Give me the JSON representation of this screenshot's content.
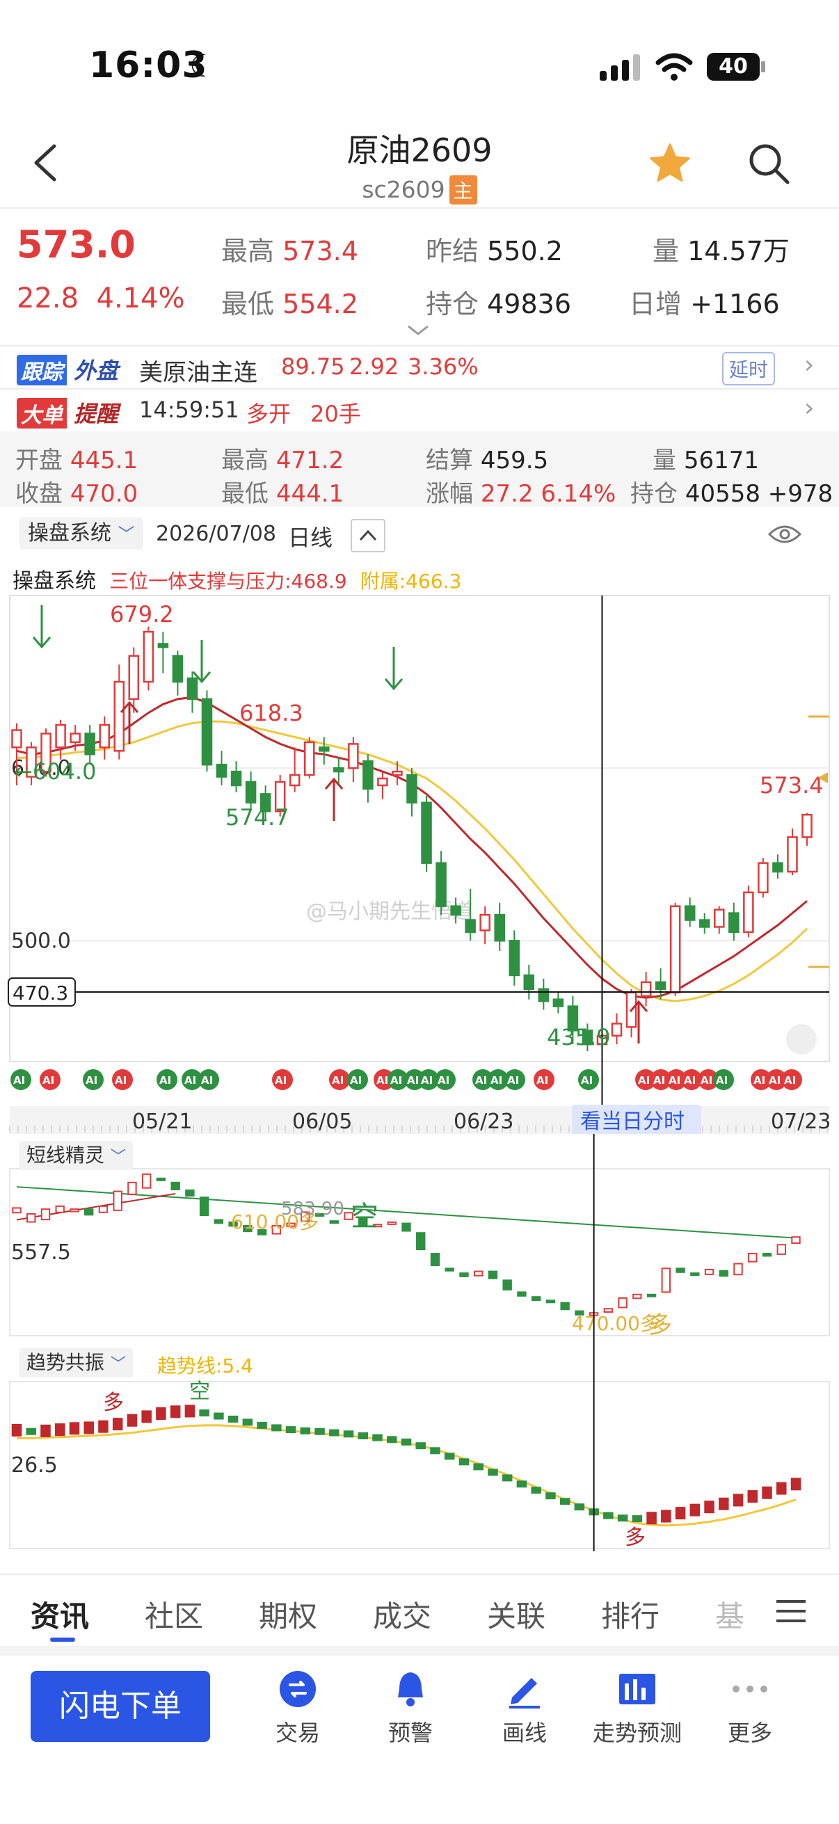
{
  "status": {
    "time": "16:03",
    "battery": "40"
  },
  "header": {
    "title": "原油2609",
    "code": "sc2609",
    "badge": "主"
  },
  "quote": {
    "price": "573.0",
    "change": "22.8",
    "change_pct": "4.14%",
    "high_label": "最高",
    "high": "573.4",
    "low_label": "最低",
    "low": "554.2",
    "prev_settle_label": "昨结",
    "prev_settle": "550.2",
    "open_interest_label": "持仓",
    "open_interest": "49836",
    "volume_label": "量",
    "volume": "14.57万",
    "daily_inc_label": "日增",
    "daily_inc": "+1166"
  },
  "track": {
    "tag1": "跟踪",
    "tag2": "外盘",
    "name": "美原油主连",
    "price": "89.75",
    "change": "2.92",
    "pct": "3.36%",
    "delay": "延时"
  },
  "alert": {
    "tag1": "大单",
    "tag2": "提醒",
    "time": "14:59:51",
    "action": "多开",
    "lots": "20手"
  },
  "daybar": {
    "open_label": "开盘",
    "open": "445.1",
    "close_label": "收盘",
    "close": "470.0",
    "high_label": "最高",
    "high": "471.2",
    "low_label": "最低",
    "low": "444.1",
    "settle_label": "结算",
    "settle": "459.5",
    "chg_label": "涨幅",
    "chg": "27.2 6.14%",
    "vol_label": "量",
    "vol": "56171",
    "oi_label": "持仓",
    "oi": "40558 +978"
  },
  "chart_toolbar": {
    "system": "操盘系统",
    "date": "2026/07/08",
    "period": "日线"
  },
  "main_chart": {
    "label": "操盘系统",
    "indicator": "三位一体支撑与压力:468.9",
    "sub_indicator": "附属:466.3",
    "y_labels": [
      "600.0",
      "500.0"
    ],
    "cursor_value": "470.3",
    "annotations": {
      "high": "679.2",
      "pt618": "618.3",
      "pt604": "←604.0",
      "pt5747": "574.7",
      "low": "435.9",
      "last": "573.4"
    },
    "x_labels": [
      "05/21",
      "06/05",
      "06/23",
      "07/23"
    ],
    "view_button": "看当日分时",
    "watermark": "@马小期先生悟道"
  },
  "chart_data": {
    "type": "candlestick",
    "ylim": [
      430,
      700
    ],
    "cursor_index": 40,
    "candles": [
      [
        612,
        622,
        590,
        626
      ],
      [
        595,
        612,
        590,
        615
      ],
      [
        598,
        620,
        595,
        623
      ],
      [
        612,
        625,
        605,
        628
      ],
      [
        615,
        620,
        610,
        625
      ],
      [
        620,
        608,
        602,
        625
      ],
      [
        612,
        625,
        605,
        630
      ],
      [
        610,
        650,
        605,
        660
      ],
      [
        640,
        665,
        632,
        670
      ],
      [
        650,
        679,
        645,
        682
      ],
      [
        672,
        670,
        655,
        679
      ],
      [
        665,
        650,
        642,
        668
      ],
      [
        652,
        640,
        632,
        656
      ],
      [
        640,
        602,
        598,
        645
      ],
      [
        602,
        595,
        590,
        610
      ],
      [
        598,
        590,
        586,
        604
      ],
      [
        592,
        580,
        576,
        598
      ],
      [
        585,
        575,
        570,
        590
      ],
      [
        575,
        592,
        572,
        596
      ],
      [
        590,
        596,
        586,
        612
      ],
      [
        596,
        615,
        594,
        618
      ],
      [
        612,
        610,
        602,
        618
      ],
      [
        600,
        598,
        590,
        606
      ],
      [
        600,
        614,
        592,
        618
      ],
      [
        604,
        588,
        580,
        608
      ],
      [
        590,
        594,
        582,
        598
      ],
      [
        596,
        598,
        590,
        604
      ],
      [
        596,
        580,
        572,
        600
      ],
      [
        580,
        545,
        540,
        584
      ],
      [
        545,
        520,
        515,
        552
      ],
      [
        520,
        515,
        510,
        525
      ],
      [
        512,
        505,
        500,
        530
      ],
      [
        506,
        515,
        498,
        520
      ],
      [
        515,
        500,
        494,
        522
      ],
      [
        500,
        480,
        474,
        506
      ],
      [
        480,
        472,
        466,
        486
      ],
      [
        472,
        465,
        460,
        478
      ],
      [
        466,
        462,
        458,
        470
      ],
      [
        462,
        448,
        440,
        468
      ],
      [
        448,
        440,
        436,
        452
      ],
      [
        440,
        445,
        436,
        450
      ],
      [
        445,
        452,
        440,
        458
      ],
      [
        450,
        470,
        444,
        472
      ],
      [
        468,
        476,
        462,
        482
      ],
      [
        476,
        472,
        466,
        484
      ],
      [
        470,
        520,
        468,
        522
      ],
      [
        520,
        512,
        508,
        525
      ],
      [
        512,
        508,
        504,
        516
      ],
      [
        508,
        518,
        504,
        520
      ],
      [
        516,
        505,
        500,
        522
      ],
      [
        505,
        528,
        502,
        532
      ],
      [
        528,
        545,
        525,
        548
      ],
      [
        545,
        540,
        536,
        550
      ],
      [
        540,
        560,
        538,
        565
      ],
      [
        560,
        573,
        555,
        574
      ]
    ],
    "ma_short": [
      610,
      608,
      609,
      611,
      613,
      614,
      616,
      620,
      626,
      632,
      637,
      640,
      641,
      638,
      633,
      628,
      623,
      618,
      614,
      611,
      609,
      608,
      606,
      604,
      601,
      598,
      595,
      591,
      585,
      577,
      568,
      559,
      551,
      542,
      533,
      523,
      513,
      504,
      495,
      486,
      478,
      472,
      468,
      467,
      468,
      471,
      476,
      481,
      486,
      491,
      497,
      503,
      509,
      516,
      523
    ],
    "ma_long": [
      606,
      606,
      607,
      608,
      609,
      610,
      611,
      613,
      615,
      618,
      621,
      624,
      626,
      627,
      627,
      626,
      624,
      622,
      620,
      618,
      616,
      614,
      612,
      610,
      608,
      605,
      602,
      598,
      594,
      588,
      581,
      573,
      565,
      556,
      547,
      537,
      527,
      517,
      507,
      498,
      489,
      481,
      474,
      469,
      466,
      465,
      466,
      468,
      471,
      475,
      480,
      486,
      492,
      499,
      507
    ]
  },
  "sub1": {
    "label": "短线精灵",
    "y_label": "557.5",
    "ann1": "610.00多",
    "ann2": "583.90",
    "ann3": "空",
    "ann4": "470.00多",
    "ann5": "多"
  },
  "sub2": {
    "label": "趋势共振",
    "indicator": "趋势线:5.4",
    "y_label": "26.5",
    "ann1": "多",
    "ann2": "空",
    "ann3": "多"
  },
  "tabs": [
    "资讯",
    "社区",
    "期权",
    "成交",
    "关联",
    "排行",
    "基"
  ],
  "bottom": {
    "primary": "闪电下单",
    "items": [
      "交易",
      "预警",
      "画线",
      "走势预测",
      "更多"
    ]
  }
}
